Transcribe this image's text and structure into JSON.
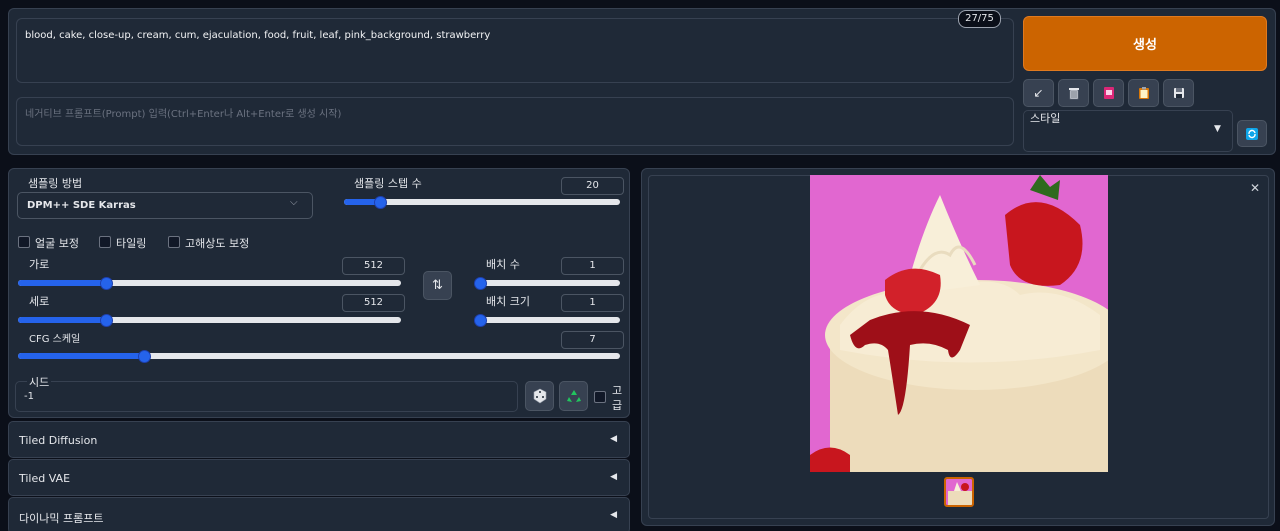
{
  "prompt": {
    "positive_text": "blood, cake, close-up, cream, cum, ejaculation, food, fruit, leaf, pink_background, strawberry",
    "negative_placeholder": "네거티브 프롬프트(Prompt) 입력(Ctrl+Enter나 Alt+Enter로 생성 시작)",
    "token_count": "27/75"
  },
  "actions": {
    "generate_label": "생성",
    "style_label": "스타일"
  },
  "settings": {
    "sampler_label": "샘플링 방법",
    "sampler_value": "DPM++ SDE Karras",
    "steps_label": "샘플링 스텝 수",
    "steps_value": "20",
    "steps_fraction": 0.13,
    "face_restore_label": "얼굴 보정",
    "tiling_label": "타일링",
    "hires_label": "고해상도 보정",
    "width_label": "가로",
    "width_value": "512",
    "width_fraction": 0.23,
    "height_label": "세로",
    "height_value": "512",
    "height_fraction": 0.23,
    "batch_count_label": "배치 수",
    "batch_count_value": "1",
    "batch_size_label": "배치 크기",
    "batch_size_value": "1",
    "cfg_label": "CFG 스케일",
    "cfg_value": "7",
    "cfg_fraction": 0.21,
    "seed_label": "시드",
    "seed_value": "-1",
    "extra_label_1": "고",
    "extra_label_2": "급"
  },
  "accordions": [
    {
      "title": "Tiled Diffusion"
    },
    {
      "title": "Tiled VAE"
    },
    {
      "title": "다이나믹 프롬프트"
    }
  ]
}
